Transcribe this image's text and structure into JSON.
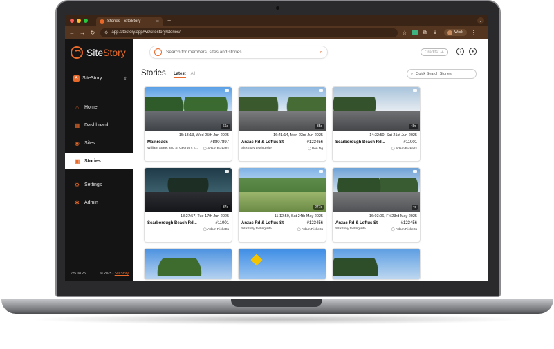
{
  "browser": {
    "tab_title": "Stories - SiteStory",
    "url": "app.sitestory.app/ws/sitestory/stories/",
    "profile_label": "Work",
    "traffic_colors": [
      "#ff5f57",
      "#febc2e",
      "#28c840"
    ]
  },
  "sidebar": {
    "brand_site": "Site",
    "brand_story": "Story",
    "org_name": "SiteStory",
    "org_initial": "S",
    "items": [
      {
        "label": "Home",
        "icon": "home-icon"
      },
      {
        "label": "Dashboard",
        "icon": "dashboard-icon"
      },
      {
        "label": "Sites",
        "icon": "map-pin-icon"
      },
      {
        "label": "Stories",
        "icon": "stories-icon",
        "active": true
      },
      {
        "label": "Settings",
        "icon": "gear-icon"
      },
      {
        "label": "Admin",
        "icon": "admin-icon"
      }
    ],
    "version": "v25.08.25",
    "copyright": "© 2025 -",
    "copyright_link": "SiteStory"
  },
  "header": {
    "search_placeholder": "Search for members, sites and stories",
    "credits": "Credits: -4"
  },
  "page": {
    "title": "Stories",
    "tab_latest": "Latest",
    "tab_all": "All",
    "quick_search_placeholder": "Quick Search Stories"
  },
  "stories": [
    {
      "timestamp": "15:13:13, Wed 25th Jun 2025",
      "site": "Mainroads",
      "id": "#8807897",
      "location": "William Street and St George's T...",
      "author": "Adam Ricketts",
      "duration": "66s"
    },
    {
      "timestamp": "16:41:14, Mon 23rd Jun 2025",
      "site": "Anzac Rd & Loftus St",
      "id": "#123456",
      "location": "SiteStory testing site",
      "author": "Ben Ng",
      "duration": "35s"
    },
    {
      "timestamp": "14:32:50, Sat 21st Jun 2025",
      "site": "Scarborough Beach Rd...",
      "id": "#11001",
      "location": "",
      "author": "Adam Ricketts",
      "duration": "49s"
    },
    {
      "timestamp": "18:27:57, Tue 17th Jun 2025",
      "site": "Scarborough Beach Rd...",
      "id": "#11001",
      "location": "",
      "author": "Adam Ricketts",
      "duration": "37s"
    },
    {
      "timestamp": "11:12:50, Sat 24th May 2025",
      "site": "Anzac Rd & Loftus St",
      "id": "#123456",
      "location": "SiteStory testing site",
      "author": "Adam Ricketts",
      "duration": "277s"
    },
    {
      "timestamp": "16:03:06, Fri 23rd May 2025",
      "site": "Anzac Rd & Loftus St",
      "id": "#123456",
      "location": "SiteStory testing site",
      "author": "Adam Ricketts",
      "duration": "~s"
    }
  ]
}
